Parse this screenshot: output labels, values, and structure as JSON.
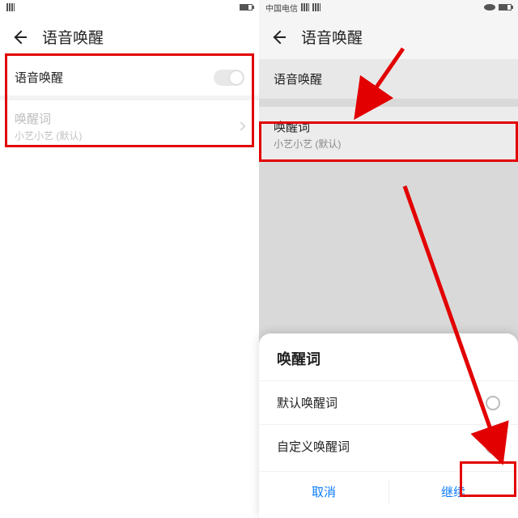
{
  "left": {
    "status": {
      "left_text": "",
      "right_text": ""
    },
    "header_title": "语音唤醒",
    "toggle_label": "语音唤醒",
    "wakeword_label": "唤醒词",
    "wakeword_value": "小艺小艺 (默认)"
  },
  "right": {
    "status_carrier": "中国电信",
    "header_title": "语音唤醒",
    "row1_label": "语音唤醒",
    "wakeword_label": "唤醒词",
    "wakeword_value": "小艺小艺 (默认)",
    "sheet": {
      "title": "唤醒词",
      "option_default": "默认唤醒词",
      "option_custom": "自定义唤醒词",
      "cancel": "取消",
      "continue": "继续"
    }
  }
}
